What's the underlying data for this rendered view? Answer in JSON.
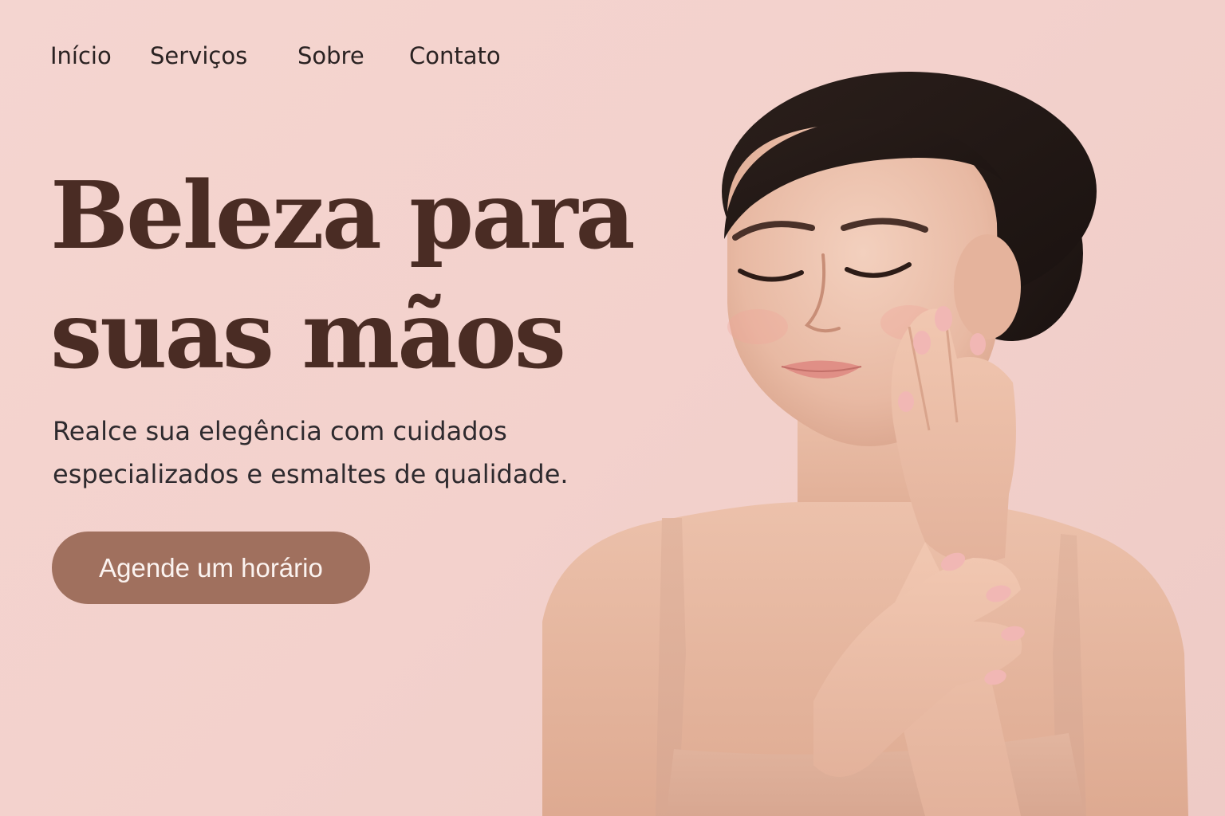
{
  "nav": {
    "items": [
      {
        "label": "Início"
      },
      {
        "label": "Serviços"
      },
      {
        "label": "Sobre"
      },
      {
        "label": "Contato"
      }
    ]
  },
  "hero": {
    "title_lines": [
      "Beleza para",
      "suas mãos"
    ],
    "subtitle_lines": [
      "Realce sua elegência com cuidados",
      "especializados e esmaltes de qualidade."
    ],
    "cta_label": "Agende um horário"
  },
  "colors": {
    "background": "#f3d1cc",
    "title": "#4a2c24",
    "text": "#2e2a2e",
    "button": "#a0705e",
    "button_text": "#fbf3f0",
    "nail_polish": "#f1b7b4"
  },
  "image": {
    "subject": "woman-with-closed-eyes-touching-face-icon"
  }
}
